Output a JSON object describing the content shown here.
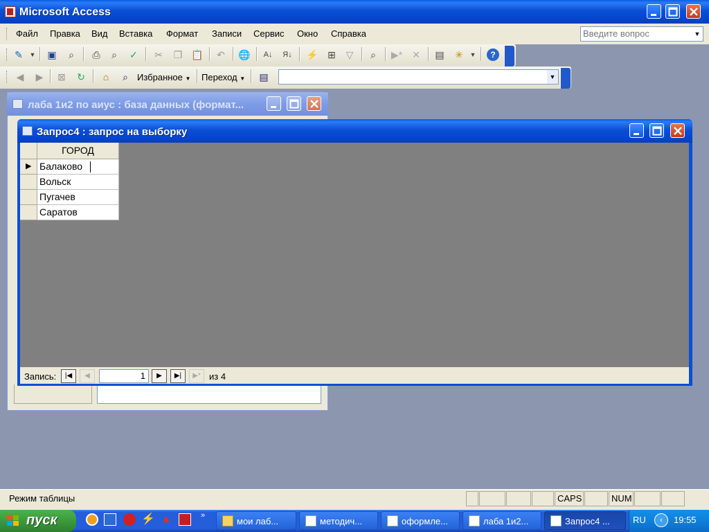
{
  "app": {
    "title": "Microsoft Access",
    "help_placeholder": "Введите вопрос"
  },
  "menu": [
    "Файл",
    "Правка",
    "Вид",
    "Вставка",
    "Формат",
    "Записи",
    "Сервис",
    "Окно",
    "Справка"
  ],
  "web_toolbar": {
    "favorites": "Избранное",
    "go": "Переход",
    "address": ""
  },
  "db_window": {
    "title": "лаба 1и2 по аиус : база данных (формат..."
  },
  "query_window": {
    "title": "Запрос4 : запрос на выборку",
    "column_header": "ГОРОД",
    "rows": [
      "Балаково",
      "Вольск",
      "Пугачев",
      "Саратов"
    ],
    "record_label": "Запись:",
    "record_number": "1",
    "record_total": "из 4"
  },
  "status_bar": {
    "mode": "Режим таблицы",
    "caps": "CAPS",
    "num": "NUM"
  },
  "taskbar": {
    "start": "пуск",
    "buttons": [
      "мои лаб...",
      "методич...",
      "оформле...",
      "лаба 1и2...",
      "Запрос4 ..."
    ],
    "lang": "RU",
    "time": "19:55"
  },
  "colors": {
    "title_blue": "#0a4fd6",
    "taskbar": "#245edb",
    "start_green": "#3c9a3c",
    "mdi_bg": "#8c96ae",
    "query_bg": "#808080"
  },
  "icons": [
    "access-app-icon",
    "save-icon",
    "print-icon",
    "search-icon",
    "help-icon",
    "home-icon",
    "back-icon",
    "forward-icon"
  ]
}
